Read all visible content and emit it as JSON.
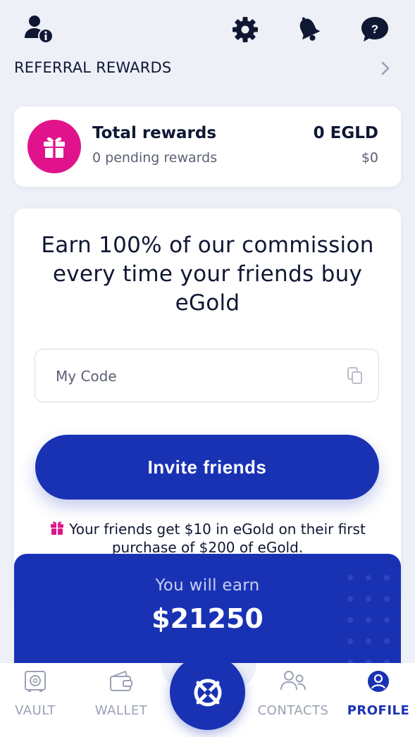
{
  "header": {
    "section_title": "REFERRAL REWARDS",
    "icons": [
      "user-info-icon",
      "gear-icon",
      "bell-icon",
      "help-icon",
      "chevron-right-icon"
    ]
  },
  "rewards": {
    "title": "Total rewards",
    "pending": "0 pending rewards",
    "amount": "0 EGLD",
    "usd": "$0"
  },
  "promo": {
    "headline": "Earn 100% of our commission every time your friends buy eGold",
    "code_placeholder": "My Code",
    "invite_label": "Invite friends",
    "note": "Your friends get $10 in eGold on their first purchase of $200 of eGold."
  },
  "earn": {
    "label": "You will earn",
    "value": "$21250"
  },
  "nav": {
    "items": [
      {
        "label": "VAULT",
        "icon": "vault-icon"
      },
      {
        "label": "WALLET",
        "icon": "wallet-icon"
      },
      {
        "label": "CONTACTS",
        "icon": "contacts-icon"
      },
      {
        "label": "PROFILE",
        "icon": "profile-icon",
        "active": true
      }
    ],
    "center_icon": "elrond-logo-icon"
  },
  "colors": {
    "primary": "#1932b4",
    "gift": "#e0138c",
    "background": "#eef0f7",
    "text": "#0f1733",
    "muted": "#5b6175"
  }
}
